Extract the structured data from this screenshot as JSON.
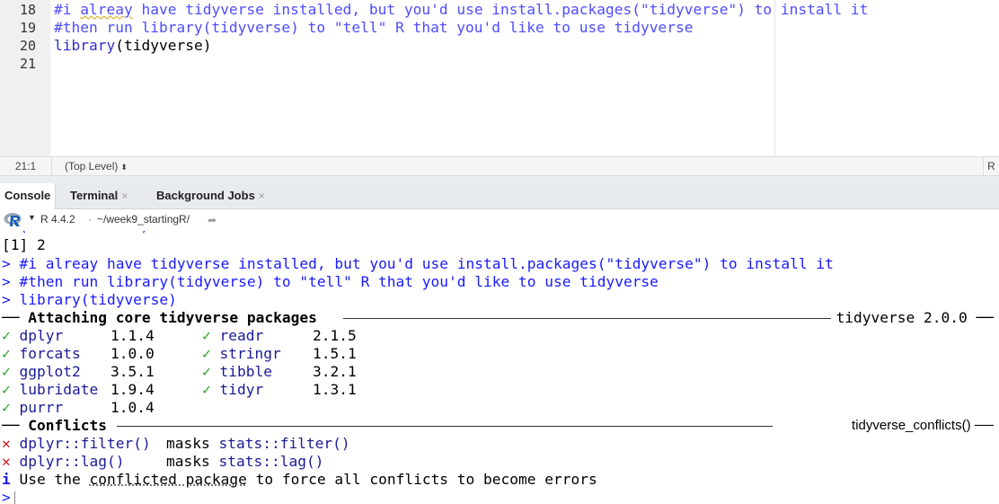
{
  "editor": {
    "lines": [
      {
        "num": "18",
        "text_a": "#i ",
        "text_squiggle": "alreay",
        "text_b": " have tidyverse installed, but you'd use install.packages(\"tidyverse\") to install it"
      },
      {
        "num": "19",
        "text": "#then run library(tidyverse) to \"tell\" R that you'd like to use tidyverse"
      },
      {
        "num": "20",
        "fn": "library",
        "paren_open": "(",
        "arg": "tidyverse",
        "paren_close": ")"
      },
      {
        "num": "21",
        "text": ""
      }
    ]
  },
  "statusbar": {
    "cursor_pos": "21:1",
    "scope": "(Top Level)",
    "scope_arrows": "⬍",
    "file_type": "R"
  },
  "tabs": [
    {
      "label": "Console",
      "closable": false,
      "active": true
    },
    {
      "label": "Terminal",
      "closable": true,
      "close": "×",
      "active": false
    },
    {
      "label": "Background Jobs",
      "closable": true,
      "close": "×",
      "active": false
    }
  ],
  "console_toolbar": {
    "r_version": "R 4.4.2",
    "separator": "·",
    "working_dir": "~/week9_startingR/",
    "go_icon": "arrow-go-icon"
  },
  "console": {
    "out1": "[1] 2",
    "cmd1": "> #i alreay have tidyverse installed, but you'd use install.packages(\"tidyverse\") to install it",
    "cmd2": "> #then run library(tidyverse) to \"tell\" R that you'd like to use tidyverse",
    "cmd3": "> library(tidyverse)",
    "attach_header": "── Attaching core tidyverse packages",
    "attach_right": "tidyverse 2.0.0 ──",
    "check": "✓",
    "packages_left": [
      {
        "name": "dplyr",
        "version": "1.1.4"
      },
      {
        "name": "forcats",
        "version": "1.0.0"
      },
      {
        "name": "ggplot2",
        "version": "3.5.1"
      },
      {
        "name": "lubridate",
        "version": "1.9.4"
      },
      {
        "name": "purrr",
        "version": "1.0.4"
      }
    ],
    "packages_right": [
      {
        "name": "readr",
        "version": "2.1.5"
      },
      {
        "name": "stringr",
        "version": "1.5.1"
      },
      {
        "name": "tibble",
        "version": "3.2.1"
      },
      {
        "name": "tidyr",
        "version": "1.3.1"
      }
    ],
    "conflicts_header": "── Conflicts",
    "conflicts_right": "tidyverse_conflicts() ──",
    "cross": "✕",
    "conflicts": [
      {
        "fn": "dplyr::filter()",
        "masks": "masks",
        "masked": "stats::filter()"
      },
      {
        "fn": "dplyr::lag()",
        "masks": "masks",
        "masked": "stats::lag()"
      }
    ],
    "info_icon": "i",
    "info_a": "Use the ",
    "info_link": "conflicted package",
    "info_b": " to force all conflicts to become errors",
    "prompt": ">"
  },
  "colors": {
    "comment": "#4d4dff",
    "console_input": "#1a1aff",
    "check_green": "#2e9e2e",
    "cross_red": "#d01818"
  }
}
